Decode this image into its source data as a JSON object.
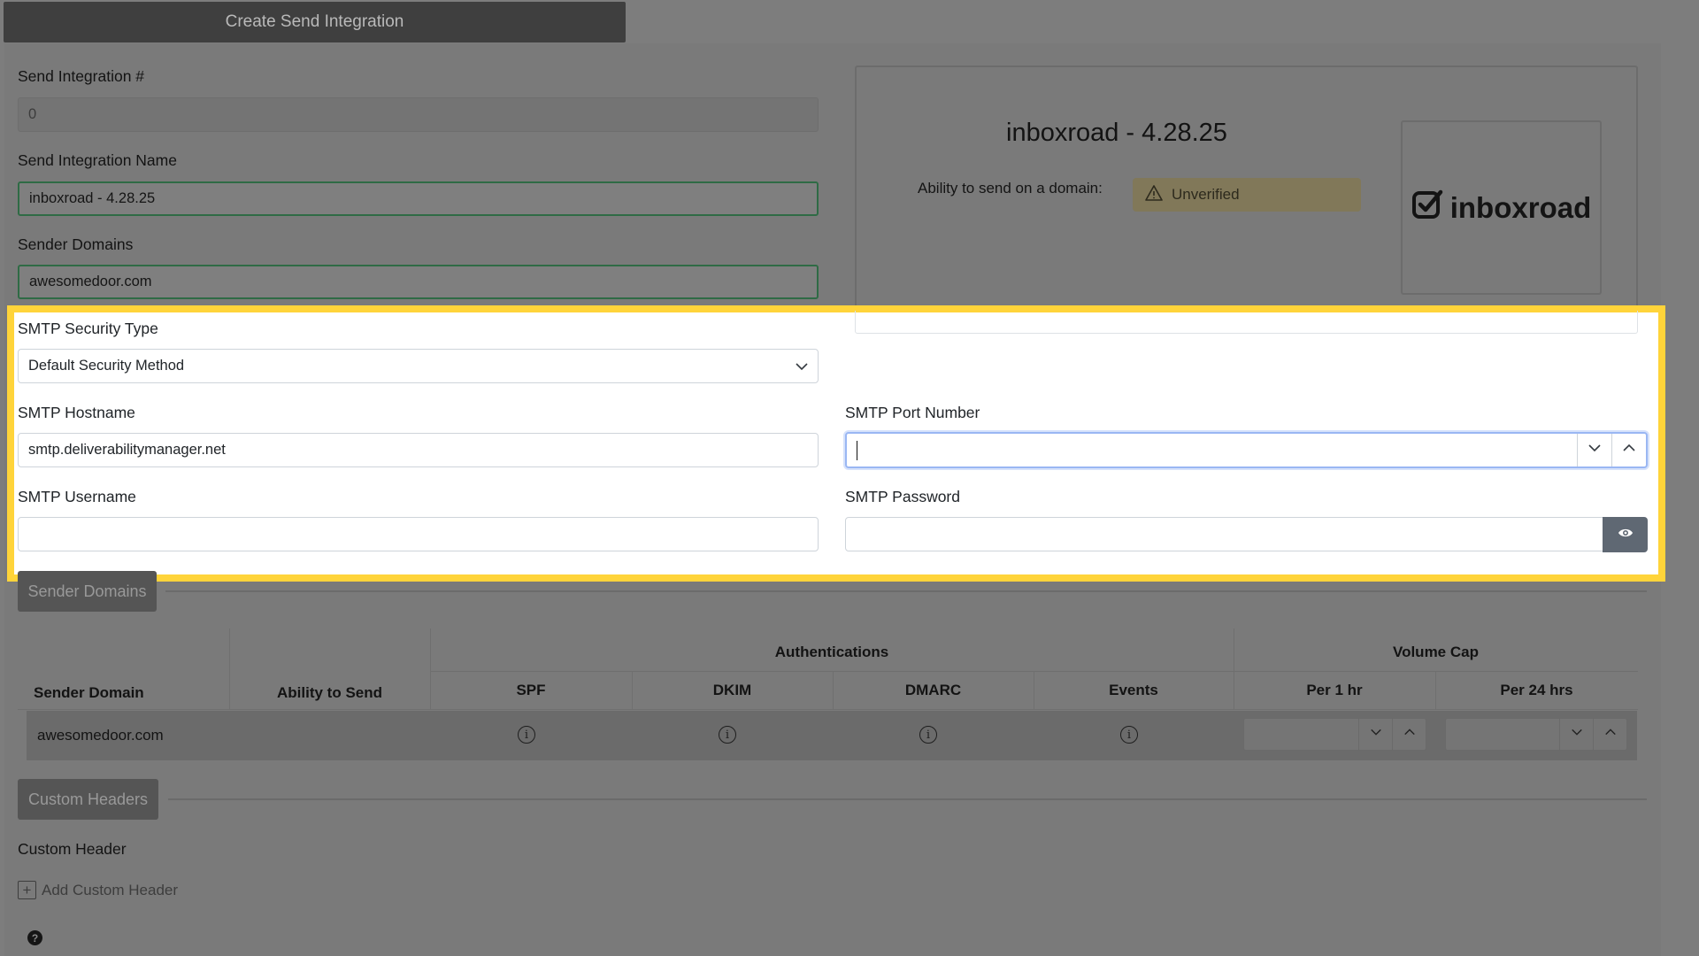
{
  "header": {
    "title": "Create Send Integration"
  },
  "form": {
    "integration_number": {
      "label": "Send Integration #",
      "value": "0"
    },
    "integration_name": {
      "label": "Send Integration Name",
      "value": "inboxroad - 4.28.25"
    },
    "sender_domains": {
      "label": "Sender Domains",
      "value": "awesomedoor.com"
    },
    "smtp_security_type": {
      "label": "SMTP Security Type",
      "value": "Default Security Method"
    },
    "smtp_hostname": {
      "label": "SMTP Hostname",
      "value": "smtp.deliverabilitymanager.net"
    },
    "smtp_port": {
      "label": "SMTP Port Number",
      "value": ""
    },
    "smtp_username": {
      "label": "SMTP Username",
      "value": ""
    },
    "smtp_password": {
      "label": "SMTP Password",
      "value": ""
    }
  },
  "info_card": {
    "title": "inboxroad - 4.28.25",
    "ability_label": "Ability to send on a domain:",
    "status": "Unverified",
    "logo_text": "inboxroad"
  },
  "sender_domains_section": {
    "button_label": "Sender Domains",
    "group_headers": {
      "authentications": "Authentications",
      "volume_cap": "Volume Cap"
    },
    "columns": [
      "Sender Domain",
      "Ability to Send",
      "SPF",
      "DKIM",
      "DMARC",
      "Events",
      "Per 1 hr",
      "Per 24 hrs"
    ],
    "rows": [
      {
        "domain": "awesomedoor.com",
        "ability": "",
        "per_1_hr": "",
        "per_24_hrs": ""
      }
    ]
  },
  "custom_headers_section": {
    "button_label": "Custom Headers",
    "label": "Custom Header",
    "add_label": "Add Custom Header"
  },
  "help": {
    "icon_text": "?"
  },
  "colors": {
    "highlight": "#ffd43a",
    "status_warning": "#e8d89a",
    "focus_border": "#9ab7f3"
  }
}
